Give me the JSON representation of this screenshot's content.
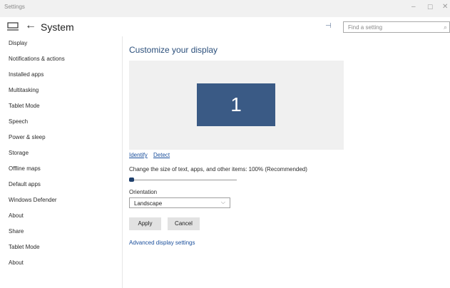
{
  "window": {
    "title": "Settings",
    "min": "–",
    "max": "☐",
    "close": "✕"
  },
  "header": {
    "back_glyph": "←",
    "section_title": "System",
    "pin_glyph": "⊣",
    "search_placeholder": "Find a setting",
    "search_glyph": "⌕"
  },
  "sidebar": {
    "items": [
      {
        "label": "Display"
      },
      {
        "label": "Notifications & actions"
      },
      {
        "label": "Installed apps"
      },
      {
        "label": "Multitasking"
      },
      {
        "label": "Tablet Mode"
      },
      {
        "label": "Speech"
      },
      {
        "label": "Power & sleep"
      },
      {
        "label": "Storage"
      },
      {
        "label": "Offline maps"
      },
      {
        "label": "Default apps"
      },
      {
        "label": "Windows Defender"
      },
      {
        "label": "About"
      },
      {
        "label": "Share"
      },
      {
        "label": "Tablet Mode"
      },
      {
        "label": "About"
      }
    ]
  },
  "main": {
    "title": "Customize your display",
    "monitor_number": "1",
    "identify_link": "Identify",
    "detect_link": "Detect",
    "scale_label": "Change the size of text, apps, and other items: 100% (Recommended)",
    "scale_fraction": 0.0,
    "orientation_label": "Orientation",
    "orientation_value": "Landscape",
    "orientation_chevron": "⌵",
    "apply_label": "Apply",
    "cancel_label": "Cancel",
    "advanced_link": "Advanced display settings"
  },
  "colors": {
    "accent": "#2b4f7b",
    "monitor": "#3a5a85",
    "link": "#1a4f9c",
    "button": "#e2e2e2"
  },
  "icons": [
    "home-icon",
    "back-arrow-icon",
    "pin-icon",
    "search-icon",
    "minimize-icon",
    "maximize-icon",
    "close-icon",
    "chevron-down-icon"
  ]
}
